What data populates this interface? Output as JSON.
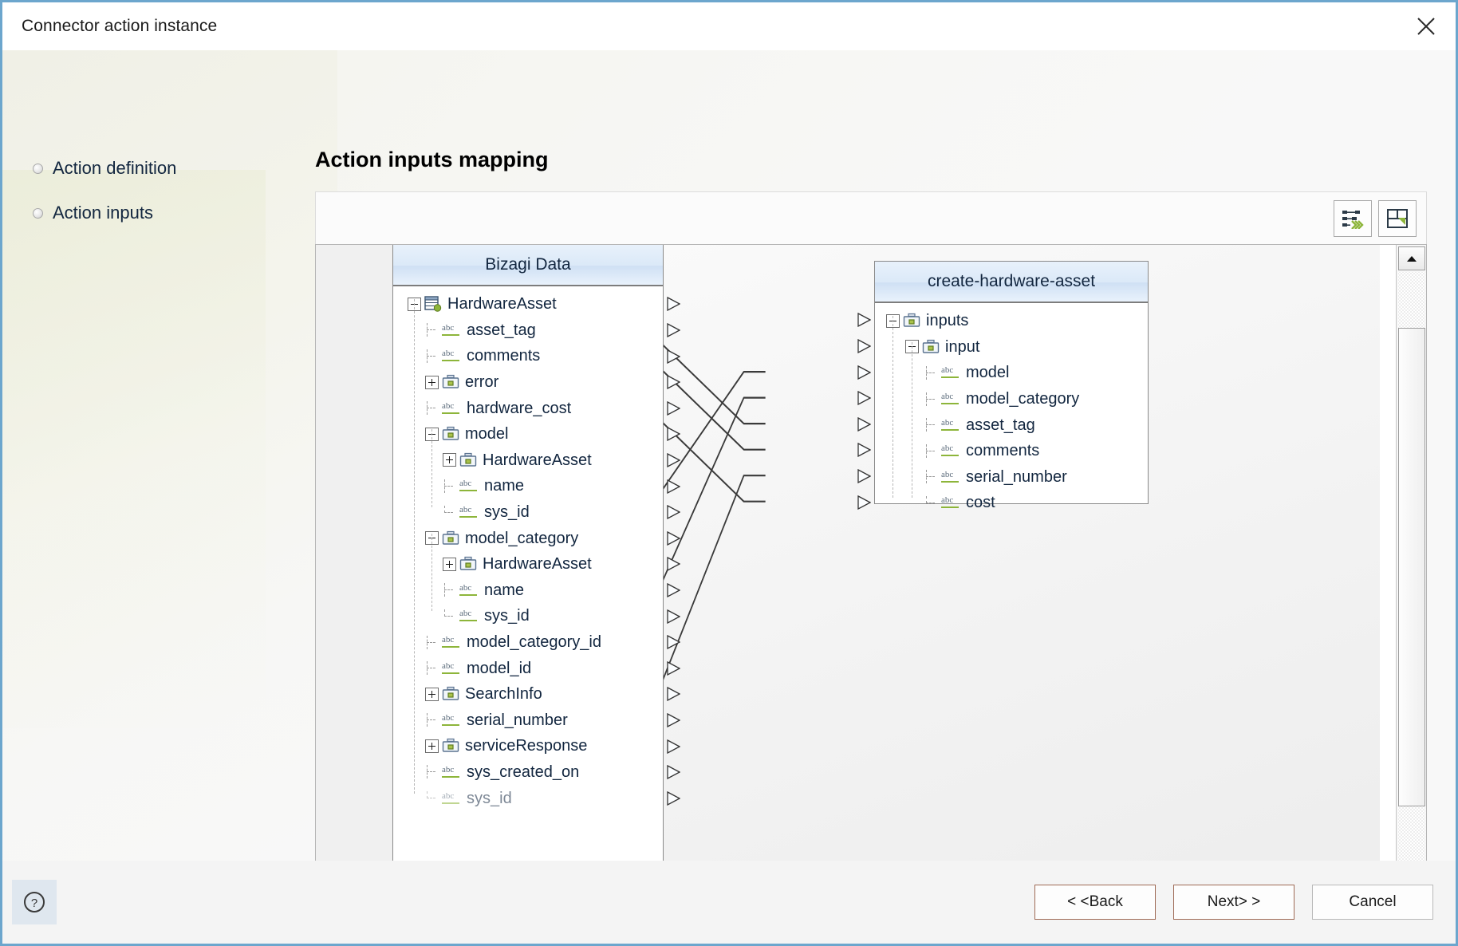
{
  "window": {
    "title": "Connector action instance",
    "close_icon": "close-icon"
  },
  "sidebar": {
    "items": [
      {
        "label": "Action definition",
        "icon": "radio-bullet-icon"
      },
      {
        "label": "Action inputs",
        "icon": "radio-bullet-icon"
      }
    ]
  },
  "main": {
    "page_title": "Action inputs mapping",
    "toolbar": {
      "buttons": [
        {
          "name": "auto-map-button",
          "icon": "auto-map-icon"
        },
        {
          "name": "expand-layout-button",
          "icon": "expand-layout-icon"
        }
      ]
    }
  },
  "mapper": {
    "left_panel": {
      "header": "Bizagi Data",
      "rows": [
        {
          "label": "HardwareAsset",
          "depth": 0,
          "icon": "entity-icon",
          "expander": "minus",
          "connected": false,
          "partial": false
        },
        {
          "label": "asset_tag",
          "depth": 1,
          "icon": "abc-icon",
          "expander": "none",
          "connected": true,
          "partial": false
        },
        {
          "label": "comments",
          "depth": 1,
          "icon": "abc-icon",
          "expander": "none",
          "connected": true,
          "partial": false
        },
        {
          "label": "error",
          "depth": 1,
          "icon": "briefcase-icon",
          "expander": "plus",
          "connected": false,
          "partial": false
        },
        {
          "label": "hardware_cost",
          "depth": 1,
          "icon": "abc-icon",
          "expander": "none",
          "connected": true,
          "partial": false
        },
        {
          "label": "model",
          "depth": 1,
          "icon": "briefcase-icon",
          "expander": "minus",
          "connected": false,
          "partial": false
        },
        {
          "label": "HardwareAsset",
          "depth": 2,
          "icon": "briefcase-icon",
          "expander": "plus",
          "connected": false,
          "partial": false
        },
        {
          "label": "name",
          "depth": 2,
          "icon": "abc-icon",
          "expander": "none",
          "connected": false,
          "partial": false
        },
        {
          "label": "sys_id",
          "depth": 2,
          "icon": "abc-icon",
          "expander": "none",
          "connected": true,
          "partial": false
        },
        {
          "label": "model_category",
          "depth": 1,
          "icon": "briefcase-icon",
          "expander": "minus",
          "connected": false,
          "partial": false
        },
        {
          "label": "HardwareAsset",
          "depth": 2,
          "icon": "briefcase-icon",
          "expander": "plus",
          "connected": false,
          "partial": false
        },
        {
          "label": "name",
          "depth": 2,
          "icon": "abc-icon",
          "expander": "none",
          "connected": false,
          "partial": false
        },
        {
          "label": "sys_id",
          "depth": 2,
          "icon": "abc-icon",
          "expander": "none",
          "connected": true,
          "partial": false
        },
        {
          "label": "model_category_id",
          "depth": 1,
          "icon": "abc-icon",
          "expander": "none",
          "connected": false,
          "partial": false
        },
        {
          "label": "model_id",
          "depth": 1,
          "icon": "abc-icon",
          "expander": "none",
          "connected": false,
          "partial": false
        },
        {
          "label": "SearchInfo",
          "depth": 1,
          "icon": "briefcase-icon",
          "expander": "plus",
          "connected": false,
          "partial": false
        },
        {
          "label": "serial_number",
          "depth": 1,
          "icon": "abc-icon",
          "expander": "none",
          "connected": true,
          "partial": false
        },
        {
          "label": "serviceResponse",
          "depth": 1,
          "icon": "briefcase-icon",
          "expander": "plus",
          "connected": false,
          "partial": false
        },
        {
          "label": "sys_created_on",
          "depth": 1,
          "icon": "abc-icon",
          "expander": "none",
          "connected": false,
          "partial": false
        },
        {
          "label": "sys_id",
          "depth": 1,
          "icon": "abc-icon",
          "expander": "none",
          "connected": false,
          "partial": true
        }
      ]
    },
    "right_panel": {
      "header": "create-hardware-asset",
      "rows": [
        {
          "label": "inputs",
          "depth": 0,
          "icon": "briefcase-icon",
          "expander": "minus",
          "connected": false
        },
        {
          "label": "input",
          "depth": 1,
          "icon": "briefcase-icon",
          "expander": "minus",
          "connected": false
        },
        {
          "label": "model",
          "depth": 2,
          "icon": "abc-icon",
          "expander": "none",
          "connected": true
        },
        {
          "label": "model_category",
          "depth": 2,
          "icon": "abc-icon",
          "expander": "none",
          "connected": true
        },
        {
          "label": "asset_tag",
          "depth": 2,
          "icon": "abc-icon",
          "expander": "none",
          "connected": true
        },
        {
          "label": "comments",
          "depth": 2,
          "icon": "abc-icon",
          "expander": "none",
          "connected": true
        },
        {
          "label": "serial_number",
          "depth": 2,
          "icon": "abc-icon",
          "expander": "none",
          "connected": true
        },
        {
          "label": "cost",
          "depth": 2,
          "icon": "abc-icon",
          "expander": "none",
          "connected": true
        }
      ]
    },
    "mappings": [
      {
        "from": "asset_tag",
        "to": "asset_tag"
      },
      {
        "from": "comments",
        "to": "comments"
      },
      {
        "from": "hardware_cost",
        "to": "cost"
      },
      {
        "from": "model.sys_id",
        "to": "model"
      },
      {
        "from": "model_category.sys_id",
        "to": "model_category"
      },
      {
        "from": "serial_number",
        "to": "serial_number"
      }
    ],
    "scrollbar": {
      "up_icon": "scroll-up-icon",
      "down_icon": "scroll-down-icon"
    }
  },
  "footer": {
    "help_icon": "help-icon",
    "buttons": [
      {
        "name": "back-button",
        "label": "< <Back"
      },
      {
        "name": "next-button",
        "label": "Next> >"
      },
      {
        "name": "cancel-button",
        "label": "Cancel"
      }
    ]
  },
  "colors": {
    "window_border": "#6ca6cd",
    "tree_header": "#dbe9f8",
    "accent_green": "#8db53a",
    "text": "#12263f"
  }
}
